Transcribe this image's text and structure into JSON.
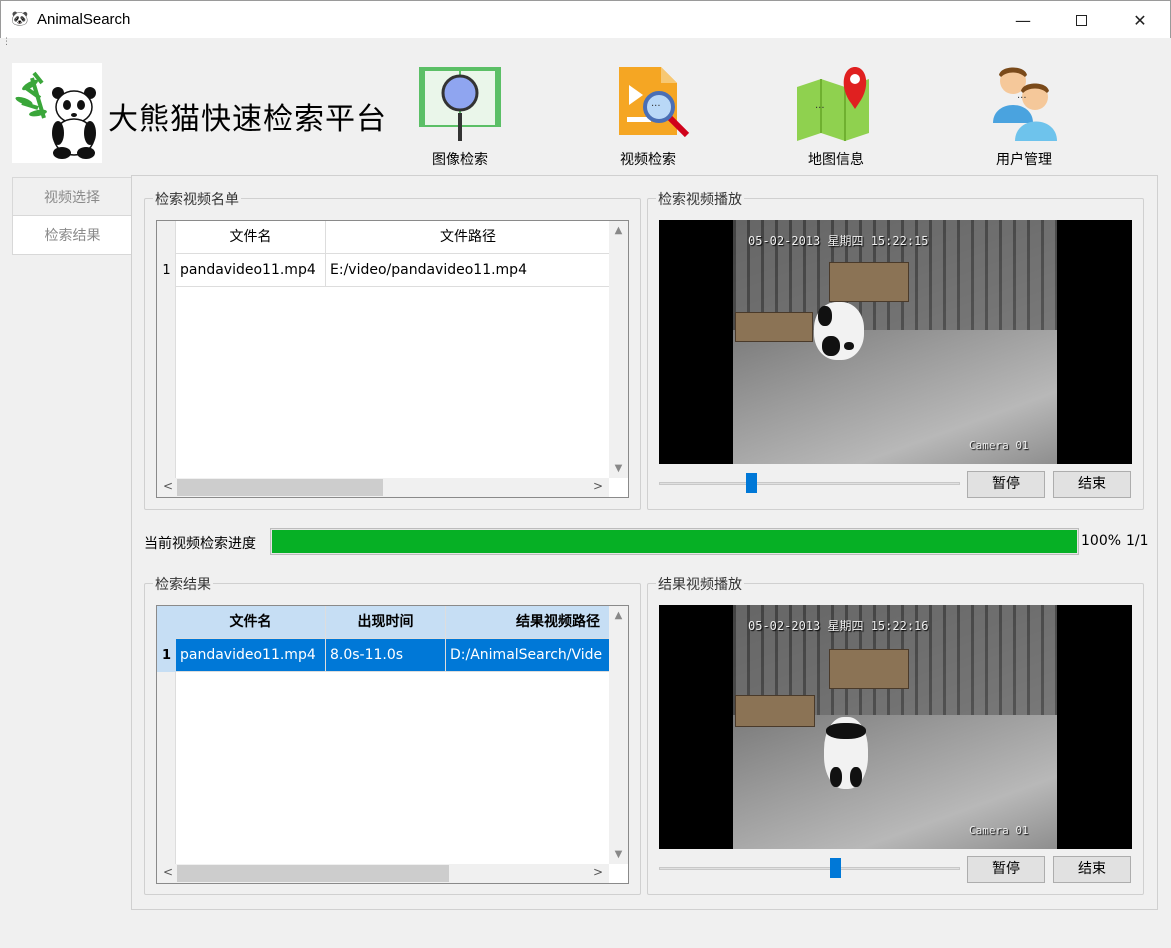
{
  "window": {
    "title": "AnimalSearch",
    "minimize": "—",
    "close": "✕"
  },
  "header": {
    "app_name": "大熊猫快速检索平台"
  },
  "toolbar": [
    {
      "label": "图像检索",
      "icon": "image-search-icon"
    },
    {
      "label": "视频检索",
      "icon": "video-search-icon"
    },
    {
      "label": "地图信息",
      "icon": "map-info-icon"
    },
    {
      "label": "用户管理",
      "icon": "user-management-icon"
    }
  ],
  "left_tabs": [
    {
      "label": "视频选择"
    },
    {
      "label": "检索结果"
    }
  ],
  "video_list": {
    "title": "检索视频名单",
    "columns": [
      "文件名",
      "文件路径"
    ],
    "rows": [
      {
        "num": "1",
        "file": "pandavideo11.mp4",
        "path": "E:/video/pandavideo11.mp4"
      }
    ]
  },
  "search_player": {
    "title": "检索视频播放",
    "timestamp": "05-02-2013 星期四 15:22:15",
    "camera": "Camera 01",
    "slider_fraction": 0.3,
    "pause_label": "暂停",
    "stop_label": "结束"
  },
  "progress": {
    "label": "当前视频检索进度",
    "percent": 100,
    "percent_text": "100%",
    "count_text": "1/1",
    "color": "#06b025"
  },
  "results": {
    "title": "检索结果",
    "columns": [
      "文件名",
      "出现时间",
      "结果视频路径"
    ],
    "rows": [
      {
        "num": "1",
        "file": "pandavideo11.mp4",
        "time": "8.0s-11.0s",
        "path": "D:/AnimalSearch/Vide"
      }
    ],
    "selection_color": "#0078d7"
  },
  "result_player": {
    "title": "结果视频播放",
    "timestamp": "05-02-2013 星期四 15:22:16",
    "camera": "Camera 01",
    "slider_fraction": 0.59,
    "pause_label": "暂停",
    "stop_label": "结束"
  }
}
